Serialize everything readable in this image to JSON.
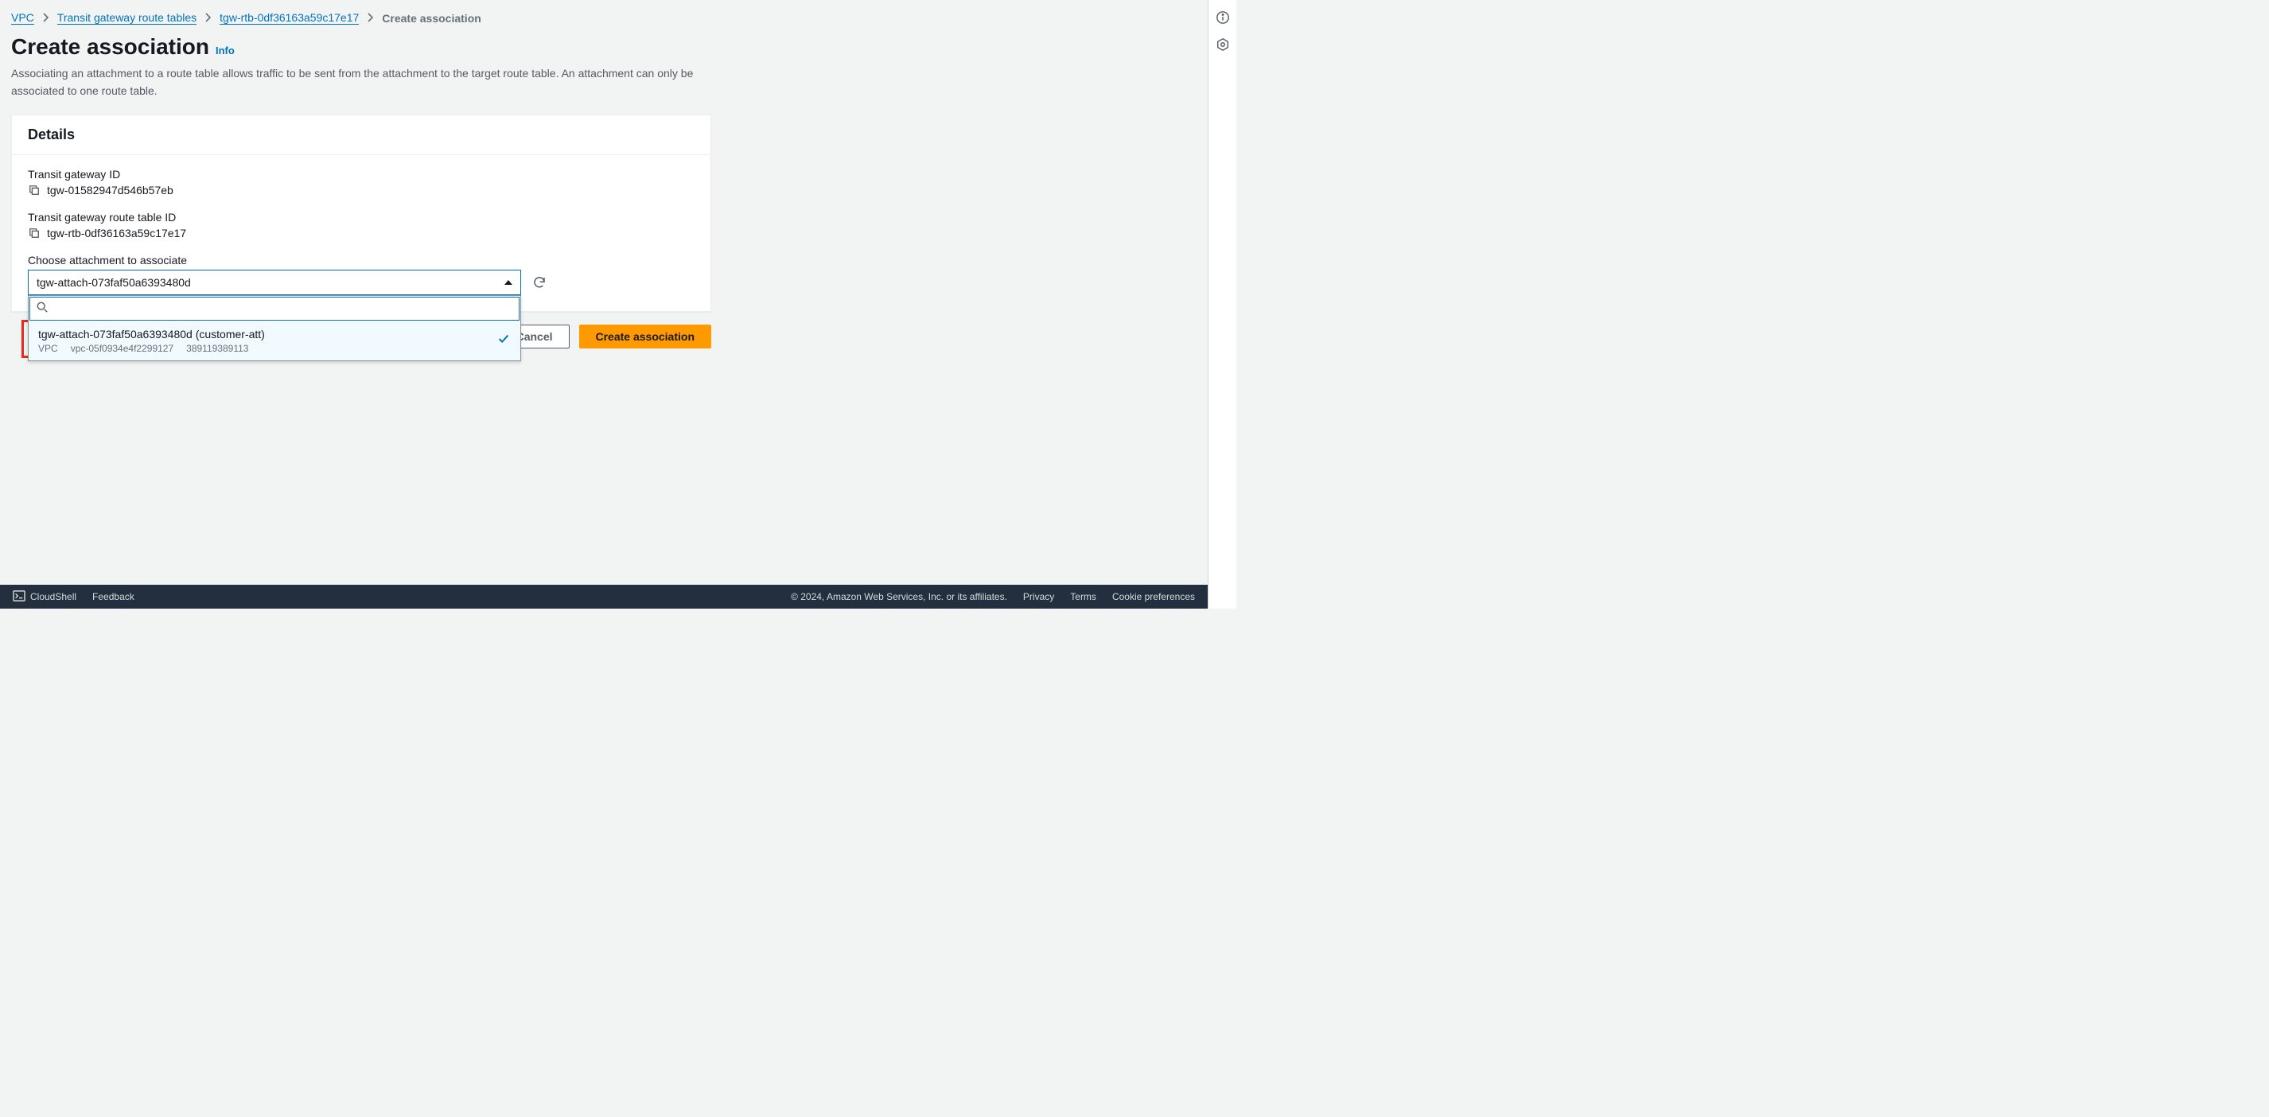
{
  "breadcrumb": {
    "items": [
      {
        "label": "VPC",
        "link": true
      },
      {
        "label": "Transit gateway route tables",
        "link": true
      },
      {
        "label": "tgw-rtb-0df36163a59c17e17",
        "link": true
      },
      {
        "label": "Create association",
        "link": false
      }
    ]
  },
  "page": {
    "title": "Create association",
    "info": "Info",
    "description": "Associating an attachment to a route table allows traffic to be sent from the attachment to the target route table. An attachment can only be associated to one route table."
  },
  "details": {
    "heading": "Details",
    "tgw_id_label": "Transit gateway ID",
    "tgw_id_value": "tgw-01582947d546b57eb",
    "rtb_id_label": "Transit gateway route table ID",
    "rtb_id_value": "tgw-rtb-0df36163a59c17e17",
    "choose_label": "Choose attachment to associate",
    "selected_value": "tgw-attach-073faf50a6393480d",
    "search_value": ""
  },
  "dropdown": {
    "option": {
      "title": "tgw-attach-073faf50a6393480d (customer-att)",
      "type": "VPC",
      "vpc_id": "vpc-05f0934e4f2299127",
      "account": "389119389113"
    }
  },
  "actions": {
    "cancel": "Cancel",
    "create": "Create association"
  },
  "footer": {
    "cloudshell": "CloudShell",
    "feedback": "Feedback",
    "copyright": "© 2024, Amazon Web Services, Inc. or its affiliates.",
    "privacy": "Privacy",
    "terms": "Terms",
    "cookies": "Cookie preferences"
  }
}
